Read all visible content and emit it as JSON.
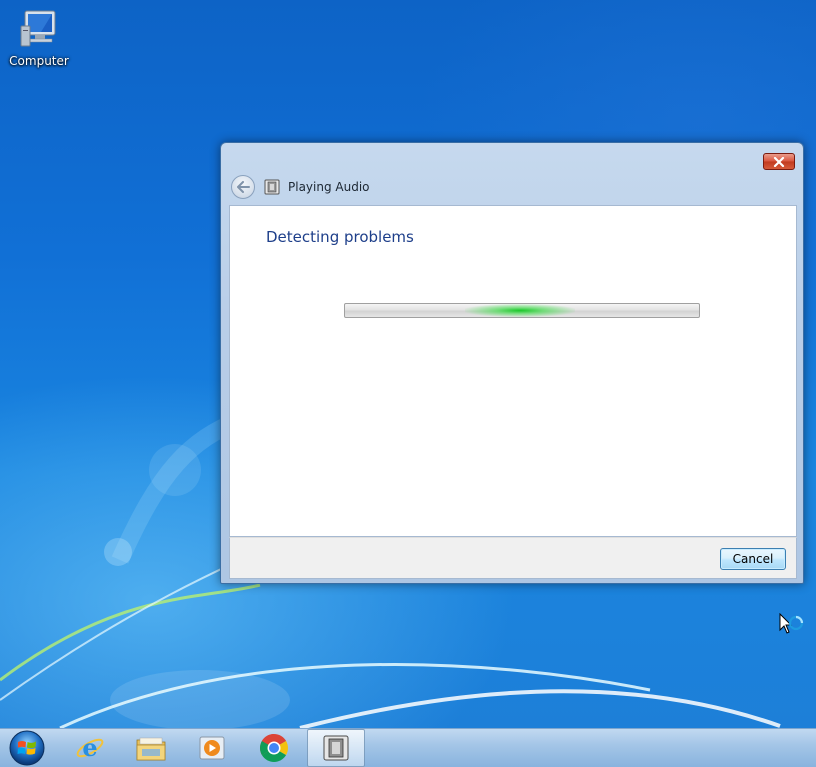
{
  "desktop": {
    "icons": [
      {
        "label": "Computer",
        "icon": "computer-icon"
      }
    ]
  },
  "dialog": {
    "title": "Playing Audio",
    "title_icon": "troubleshooter-icon",
    "heading": "Detecting problems",
    "progress": {
      "state": "indeterminate",
      "color": "#22c83a"
    },
    "buttons": {
      "cancel": "Cancel"
    }
  },
  "taskbar": {
    "items": [
      {
        "name": "start",
        "icon": "windows-logo-icon"
      },
      {
        "name": "internet-explorer",
        "icon": "internet-explorer-icon"
      },
      {
        "name": "windows-explorer",
        "icon": "folder-icon"
      },
      {
        "name": "windows-media-player",
        "icon": "media-player-icon"
      },
      {
        "name": "google-chrome",
        "icon": "chrome-icon"
      },
      {
        "name": "troubleshooter",
        "icon": "troubleshooter-icon",
        "active": true
      }
    ]
  },
  "colors": {
    "accent": "#1e3f8a",
    "desktop_background": "#1170d6",
    "close_button": "#c13a1f"
  }
}
